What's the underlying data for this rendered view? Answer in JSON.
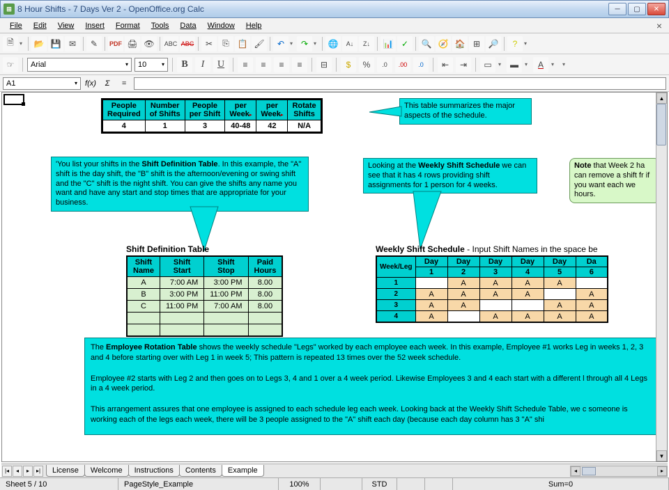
{
  "window": {
    "title": "8 Hour Shifts - 7 Days Ver 2 - OpenOffice.org Calc"
  },
  "menu": [
    "File",
    "Edit",
    "View",
    "Insert",
    "Format",
    "Tools",
    "Data",
    "Window",
    "Help"
  ],
  "formatbar": {
    "font": "Arial",
    "size": "10"
  },
  "formula": {
    "cellref": "A1",
    "fx": "f(x)",
    "sigma": "Σ",
    "eq": "="
  },
  "summary": {
    "headers": [
      "People\nRequired",
      "Number\nof Shifts",
      "People\nper Shift",
      "per\nWeek",
      "per\nWeek",
      "Rotate\nShifts"
    ],
    "values": [
      "4",
      "1",
      "3",
      "40-48",
      "42",
      "N/A"
    ]
  },
  "callouts": {
    "summary": "This table summarizes the major aspects of the schedule.",
    "shiftdef": "'You list your shifts in the Shift Definition Table. In this example, the \"A\" shift is the day shift, the \"B\" shift is the afternoon/evening or swing shift and the \"C\" shift is the night shift. You can give the shifts any name you want and have any start and stop times that are appropriate for your business.",
    "shiftdef_bold": "Shift Definition Table",
    "weekly": "Looking at the Weekly Shift Schedule we can see that it has 4 rows providing shift assignments for 1 person for 4 weeks.",
    "weekly_bold": "Weekly Shift Schedule",
    "note": "Note that Week 2 ha can remove a shift fr if you want each we hours.",
    "note_bold": "Note",
    "rotation_p1a": "The ",
    "rotation_p1_bold": "Employee Rotation Table",
    "rotation_p1b": " shows the weekly schedule \"Legs\" worked by each employee each week. In this example, Employee #1 works Leg in weeks 1, 2, 3 and 4 before starting over with Leg 1 in week 5; This pattern is repeated 13 times over the 52 week schedule.",
    "rotation_p2": "Employee #2 starts with Leg 2 and then goes on to Legs 3, 4 and 1 over a 4 week period. Likewise Employees 3 and 4 each start with a different l through all 4 Legs in a 4 week period.",
    "rotation_p3": "This arrangement assures that one employee is assigned to each schedule leg each week. Looking back at the Weekly Shift Schedule Table, we c someone is working each of the legs each week, there will be 3 people assigned to the \"A\" shift each day (because each day column has 3 \"A\" shi"
  },
  "shiftdef": {
    "title": "Shift Definition Table",
    "headers": [
      "Shift\nName",
      "Shift\nStart",
      "Shift\nStop",
      "Paid\nHours"
    ],
    "rows": [
      [
        "A",
        "7:00 AM",
        "3:00 PM",
        "8.00"
      ],
      [
        "B",
        "3:00 PM",
        "11:00 PM",
        "8.00"
      ],
      [
        "C",
        "11:00 PM",
        "7:00 AM",
        "8.00"
      ]
    ]
  },
  "weekly": {
    "title_bold": "Weekly Shift Schedule",
    "title_rest": " - Input Shift Names in the space be",
    "corner": "Week/Leg",
    "day_headers": [
      [
        "Day",
        "1"
      ],
      [
        "Day",
        "2"
      ],
      [
        "Day",
        "3"
      ],
      [
        "Day",
        "4"
      ],
      [
        "Day",
        "5"
      ],
      [
        "Da",
        "6"
      ]
    ],
    "rows": [
      {
        "leg": "1",
        "cells": [
          "",
          "A",
          "A",
          "A",
          "A",
          ""
        ]
      },
      {
        "leg": "2",
        "cells": [
          "A",
          "A",
          "A",
          "A",
          "",
          "A"
        ]
      },
      {
        "leg": "3",
        "cells": [
          "A",
          "A",
          "",
          "",
          "A",
          "A"
        ]
      },
      {
        "leg": "4",
        "cells": [
          "A",
          "",
          "A",
          "A",
          "A",
          "A"
        ]
      }
    ]
  },
  "tabs": [
    "License",
    "Welcome",
    "Instructions",
    "Contents",
    "Example"
  ],
  "status": {
    "sheet": "Sheet 5 / 10",
    "pagestyle": "PageStyle_Example",
    "zoom": "100%",
    "std": "STD",
    "sum": "Sum=0"
  }
}
